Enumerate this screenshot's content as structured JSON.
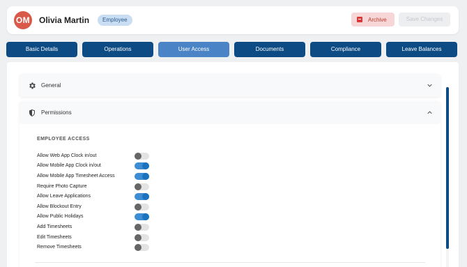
{
  "header": {
    "avatar_initials": "OM",
    "name": "Olivia Martin",
    "role_badge": "Employee",
    "archive_label": "Archive",
    "save_label": "Save Changes"
  },
  "tabs": [
    {
      "label": "Basic Details",
      "active": false
    },
    {
      "label": "Operations",
      "active": false
    },
    {
      "label": "User Access",
      "active": true
    },
    {
      "label": "Documents",
      "active": false
    },
    {
      "label": "Compliance",
      "active": false
    },
    {
      "label": "Leave Balances",
      "active": false
    }
  ],
  "sections": {
    "general": {
      "title": "General",
      "icon": "gear-icon",
      "expanded": false
    },
    "permissions": {
      "title": "Permissions",
      "icon": "shield-icon",
      "expanded": true
    }
  },
  "employee_access": {
    "heading": "EMPLOYEE ACCESS",
    "items": [
      {
        "label": "Allow Web App Clock in/out",
        "enabled": false
      },
      {
        "label": "Allow Mobile App Clock in/out",
        "enabled": true
      },
      {
        "label": "Allow Mobile App Timesheet Access",
        "enabled": true
      },
      {
        "label": "Require Photo Capture",
        "enabled": false
      },
      {
        "label": "Allow Leave Applications",
        "enabled": true
      },
      {
        "label": "Allow Blockout Entry",
        "enabled": false
      },
      {
        "label": "Allow Public Holidays",
        "enabled": true
      },
      {
        "label": "Add Timesheets",
        "enabled": false
      },
      {
        "label": "Edit Timesheets",
        "enabled": false
      },
      {
        "label": "Remove Timesheets",
        "enabled": false
      }
    ]
  },
  "colors": {
    "primary": "#0d4b84",
    "active_tab": "#4a84c6",
    "avatar": "#d95a4a",
    "toggle_on": "#1c73bd",
    "archive": "#d63b3b"
  }
}
